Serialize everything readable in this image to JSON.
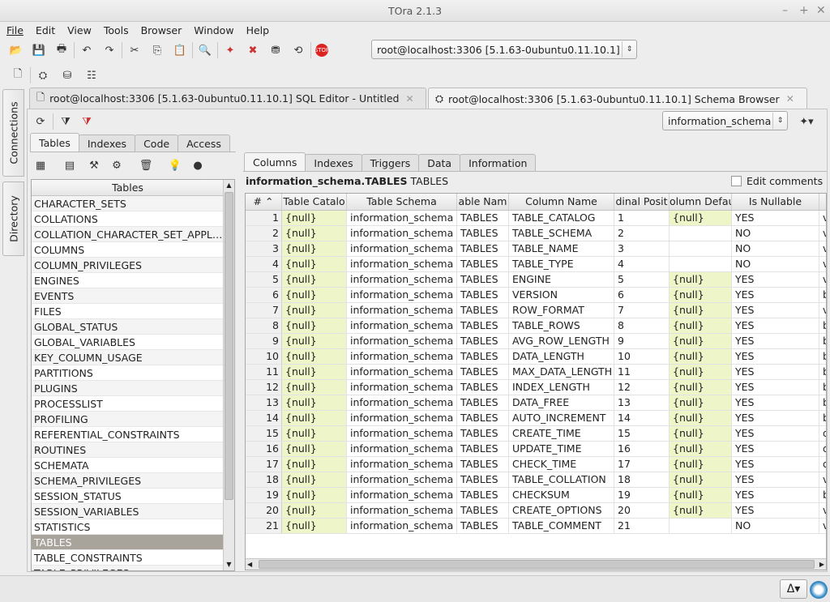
{
  "window": {
    "title": "TOra 2.1.3",
    "controls": [
      "–",
      "+",
      "✕"
    ]
  },
  "menu": [
    "File",
    "Edit",
    "View",
    "Tools",
    "Browser",
    "Window",
    "Help"
  ],
  "connection_combo": "root@localhost:3306 [5.1.63-0ubuntu0.11.10.1]",
  "side_tabs": [
    "Connections",
    "Directory"
  ],
  "doc_tabs": [
    {
      "label": "root@localhost:3306 [5.1.63-0ubuntu0.11.10.1] SQL Editor - Untitled"
    },
    {
      "label": "root@localhost:3306 [5.1.63-0ubuntu0.11.10.1] Schema Browser"
    }
  ],
  "schema_combo": "information_schema",
  "left_tabs": [
    "Tables",
    "Indexes",
    "Code",
    "Access"
  ],
  "tables_header": "Tables",
  "tables": [
    "CHARACTER_SETS",
    "COLLATIONS",
    "COLLATION_CHARACTER_SET_APPLI...",
    "COLUMNS",
    "COLUMN_PRIVILEGES",
    "ENGINES",
    "EVENTS",
    "FILES",
    "GLOBAL_STATUS",
    "GLOBAL_VARIABLES",
    "KEY_COLUMN_USAGE",
    "PARTITIONS",
    "PLUGINS",
    "PROCESSLIST",
    "PROFILING",
    "REFERENTIAL_CONSTRAINTS",
    "ROUTINES",
    "SCHEMATA",
    "SCHEMA_PRIVILEGES",
    "SESSION_STATUS",
    "SESSION_VARIABLES",
    "STATISTICS",
    "TABLES",
    "TABLE_CONSTRAINTS",
    "TABLE_PRIVILEGES"
  ],
  "selected_table": "TABLES",
  "right_tabs": [
    "Columns",
    "Indexes",
    "Triggers",
    "Data",
    "Information"
  ],
  "object_title": {
    "name": "information_schema.TABLES",
    "type": "TABLES"
  },
  "edit_comments": "Edit comments",
  "grid": {
    "columns": [
      "#",
      "Table Catalog",
      "Table Schema",
      "Table Name",
      "Column Name",
      "Ordinal Position",
      "Column Default",
      "Is Nullable",
      ""
    ],
    "header_display": [
      "# ⌃",
      "Table Catalo",
      "Table Schema",
      "able Nam",
      "Column Name",
      "dinal Posit",
      "olumn Defau",
      "Is Nullable",
      ""
    ],
    "rows": [
      [
        "1",
        "{null}",
        "information_schema",
        "TABLES",
        "TABLE_CATALOG",
        "1",
        "{null}",
        "YES",
        "v"
      ],
      [
        "2",
        "{null}",
        "information_schema",
        "TABLES",
        "TABLE_SCHEMA",
        "2",
        "",
        "NO",
        "v"
      ],
      [
        "3",
        "{null}",
        "information_schema",
        "TABLES",
        "TABLE_NAME",
        "3",
        "",
        "NO",
        "v"
      ],
      [
        "4",
        "{null}",
        "information_schema",
        "TABLES",
        "TABLE_TYPE",
        "4",
        "",
        "NO",
        "v"
      ],
      [
        "5",
        "{null}",
        "information_schema",
        "TABLES",
        "ENGINE",
        "5",
        "{null}",
        "YES",
        "v"
      ],
      [
        "6",
        "{null}",
        "information_schema",
        "TABLES",
        "VERSION",
        "6",
        "{null}",
        "YES",
        "b"
      ],
      [
        "7",
        "{null}",
        "information_schema",
        "TABLES",
        "ROW_FORMAT",
        "7",
        "{null}",
        "YES",
        "v"
      ],
      [
        "8",
        "{null}",
        "information_schema",
        "TABLES",
        "TABLE_ROWS",
        "8",
        "{null}",
        "YES",
        "b"
      ],
      [
        "9",
        "{null}",
        "information_schema",
        "TABLES",
        "AVG_ROW_LENGTH",
        "9",
        "{null}",
        "YES",
        "b"
      ],
      [
        "10",
        "{null}",
        "information_schema",
        "TABLES",
        "DATA_LENGTH",
        "10",
        "{null}",
        "YES",
        "b"
      ],
      [
        "11",
        "{null}",
        "information_schema",
        "TABLES",
        "MAX_DATA_LENGTH",
        "11",
        "{null}",
        "YES",
        "b"
      ],
      [
        "12",
        "{null}",
        "information_schema",
        "TABLES",
        "INDEX_LENGTH",
        "12",
        "{null}",
        "YES",
        "b"
      ],
      [
        "13",
        "{null}",
        "information_schema",
        "TABLES",
        "DATA_FREE",
        "13",
        "{null}",
        "YES",
        "b"
      ],
      [
        "14",
        "{null}",
        "information_schema",
        "TABLES",
        "AUTO_INCREMENT",
        "14",
        "{null}",
        "YES",
        "b"
      ],
      [
        "15",
        "{null}",
        "information_schema",
        "TABLES",
        "CREATE_TIME",
        "15",
        "{null}",
        "YES",
        "d"
      ],
      [
        "16",
        "{null}",
        "information_schema",
        "TABLES",
        "UPDATE_TIME",
        "16",
        "{null}",
        "YES",
        "d"
      ],
      [
        "17",
        "{null}",
        "information_schema",
        "TABLES",
        "CHECK_TIME",
        "17",
        "{null}",
        "YES",
        "d"
      ],
      [
        "18",
        "{null}",
        "information_schema",
        "TABLES",
        "TABLE_COLLATION",
        "18",
        "{null}",
        "YES",
        "v"
      ],
      [
        "19",
        "{null}",
        "information_schema",
        "TABLES",
        "CHECKSUM",
        "19",
        "{null}",
        "YES",
        "b"
      ],
      [
        "20",
        "{null}",
        "information_schema",
        "TABLES",
        "CREATE_OPTIONS",
        "20",
        "{null}",
        "YES",
        "v"
      ],
      [
        "21",
        "{null}",
        "information_schema",
        "TABLES",
        "TABLE_COMMENT",
        "21",
        "",
        "NO",
        "v"
      ]
    ]
  },
  "colors": {
    "null_cell": "#eef5c8",
    "selected_row": "#a8a49c"
  }
}
